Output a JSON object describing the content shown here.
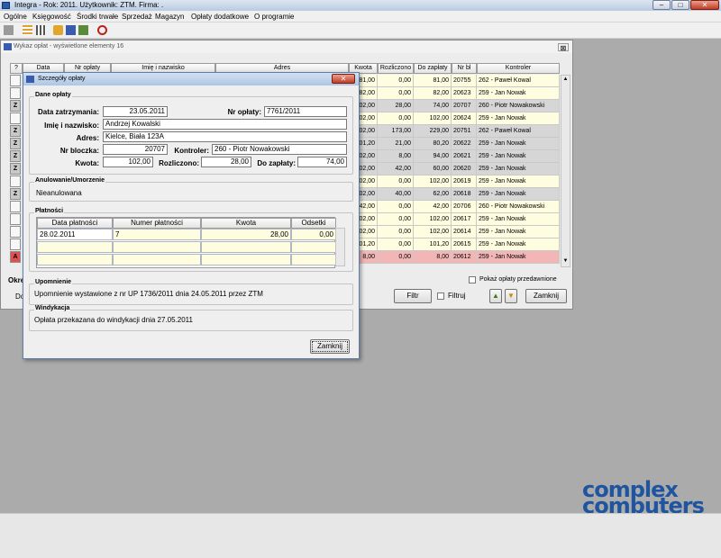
{
  "window": {
    "title": "Integra -  Rok: 2011. Użytkownik: ZTM. Firma: .",
    "min_label": "–",
    "max_label": "□",
    "close_label": "✕"
  },
  "menu": [
    "Ogólne",
    "Księgowość",
    "Środki trwałe",
    "Sprzedaż",
    "Magazyn",
    "Opłaty dodatkowe",
    "O programie"
  ],
  "list_window": {
    "title": "Wykaz opłat - wyświetlone elementy 16",
    "close_label": "⊠",
    "columns": [
      "?",
      "Data",
      "Nr opłaty",
      "Imię i nazwisko",
      "Adres",
      "Kwota",
      "Rozliczono",
      "Do zapłaty",
      "Nr bl",
      "Kontroler"
    ],
    "rows": [
      {
        "flag": "",
        "kwota": "81,00",
        "rozliczono": "0,00",
        "do_zaplaty": "81,00",
        "nr_bl": "20755",
        "kontroler": "262 - Paweł Kowal"
      },
      {
        "flag": "",
        "kwota": "82,00",
        "rozliczono": "0,00",
        "do_zaplaty": "82,00",
        "nr_bl": "20623",
        "kontroler": "259 - Jan Nowak"
      },
      {
        "flag": "Z",
        "kwota": "02,00",
        "rozliczono": "28,00",
        "do_zaplaty": "74,00",
        "nr_bl": "20707",
        "kontroler": "260 - Piotr Nowakowski"
      },
      {
        "flag": "",
        "kwota": "02,00",
        "rozliczono": "0,00",
        "do_zaplaty": "102,00",
        "nr_bl": "20624",
        "kontroler": "259 - Jan Nowak"
      },
      {
        "flag": "Z",
        "kwota": "02,00",
        "rozliczono": "173,00",
        "do_zaplaty": "229,00",
        "nr_bl": "20751",
        "kontroler": "262 - Paweł Kowal"
      },
      {
        "flag": "Z",
        "kwota": "01,20",
        "rozliczono": "21,00",
        "do_zaplaty": "80,20",
        "nr_bl": "20622",
        "kontroler": "259 - Jan Nowak"
      },
      {
        "flag": "Z",
        "kwota": "02,00",
        "rozliczono": "8,00",
        "do_zaplaty": "94,00",
        "nr_bl": "20621",
        "kontroler": "259 - Jan Nowak"
      },
      {
        "flag": "Z",
        "kwota": "02,00",
        "rozliczono": "42,00",
        "do_zaplaty": "60,00",
        "nr_bl": "20620",
        "kontroler": "259 - Jan Nowak"
      },
      {
        "flag": "",
        "kwota": "02,00",
        "rozliczono": "0,00",
        "do_zaplaty": "102,00",
        "nr_bl": "20619",
        "kontroler": "259 - Jan Nowak"
      },
      {
        "flag": "Z",
        "kwota": "02,00",
        "rozliczono": "40,00",
        "do_zaplaty": "62,00",
        "nr_bl": "20618",
        "kontroler": "259 - Jan Nowak"
      },
      {
        "flag": "",
        "kwota": "42,00",
        "rozliczono": "0,00",
        "do_zaplaty": "42,00",
        "nr_bl": "20706",
        "kontroler": "260 - Piotr Nowakowski"
      },
      {
        "flag": "",
        "kwota": "02,00",
        "rozliczono": "0,00",
        "do_zaplaty": "102,00",
        "nr_bl": "20617",
        "kontroler": "259 - Jan Nowak"
      },
      {
        "flag": "",
        "kwota": "02,00",
        "rozliczono": "0,00",
        "do_zaplaty": "102,00",
        "nr_bl": "20614",
        "kontroler": "259 - Jan Nowak"
      },
      {
        "flag": "",
        "kwota": "01,20",
        "rozliczono": "0,00",
        "do_zaplaty": "101,20",
        "nr_bl": "20615",
        "kontroler": "259 - Jan Nowak"
      },
      {
        "flag": "A",
        "kwota": "8,00",
        "rozliczono": "0,00",
        "do_zaplaty": "8,00",
        "nr_bl": "20612",
        "kontroler": "259 - Jan Nowak"
      }
    ],
    "left_partial_1": "Okre",
    "left_partial_2": "Do",
    "show_overdue_label": "Pokaż opłaty przedawnione",
    "filter_button": "Filtr",
    "filter_check_label": "Filtruj",
    "close_button": "Zamknij"
  },
  "dialog": {
    "title": "Szczegóły opłaty",
    "close_label": "✕",
    "group_dane": "Dane opłaty",
    "data_label": "Data zatrzymania:",
    "data_value": "23.05.2011",
    "nr_label": "Nr opłaty:",
    "nr_value": "7761/2011",
    "imie_label": "Imię i nazwisko:",
    "imie_value": "Andrzej Kowalski",
    "adres_label": "Adres:",
    "adres_value": "Kielce, Biała 123A",
    "bloczek_label": "Nr bloczka:",
    "bloczek_value": "20707",
    "kontroler_label": "Kontroler:",
    "kontroler_value": "260 - Piotr Nowakowski",
    "kwota_label": "Kwota:",
    "kwota_value": "102,00",
    "rozliczono_label": "Rozliczono:",
    "rozliczono_value": "28,00",
    "dozaplaty_label": "Do zapłaty:",
    "dozaplaty_value": "74,00",
    "group_anul": "Anulowanie/Umorzenie",
    "anul_value": "Nieanulowana",
    "group_platnosci": "Płatności",
    "platnosci_columns": [
      "Data płatności",
      "Numer płatności",
      "Kwota",
      "Odsetki"
    ],
    "platnosci_rows": [
      [
        "28.02.2011",
        "7",
        "28,00",
        "0,00"
      ]
    ],
    "group_upomnienie": "Upomnienie",
    "upomnienie_value": "Upomnienie wystawione z nr UP 1736/2011 dnia 24.05.2011 przez ZTM",
    "group_windykacja": "Windykacja",
    "windykacja_value": "Opłata przekazana do windykacji dnia 27.05.2011",
    "zamknij": "Zamknij"
  },
  "logo": {
    "line1": "complex",
    "line2": "computers"
  },
  "colors": {
    "row_yellow": "#fffde0",
    "row_gray": "#d6d6d6",
    "row_red": "#f2b6b6",
    "accent": "#1f55a0"
  }
}
